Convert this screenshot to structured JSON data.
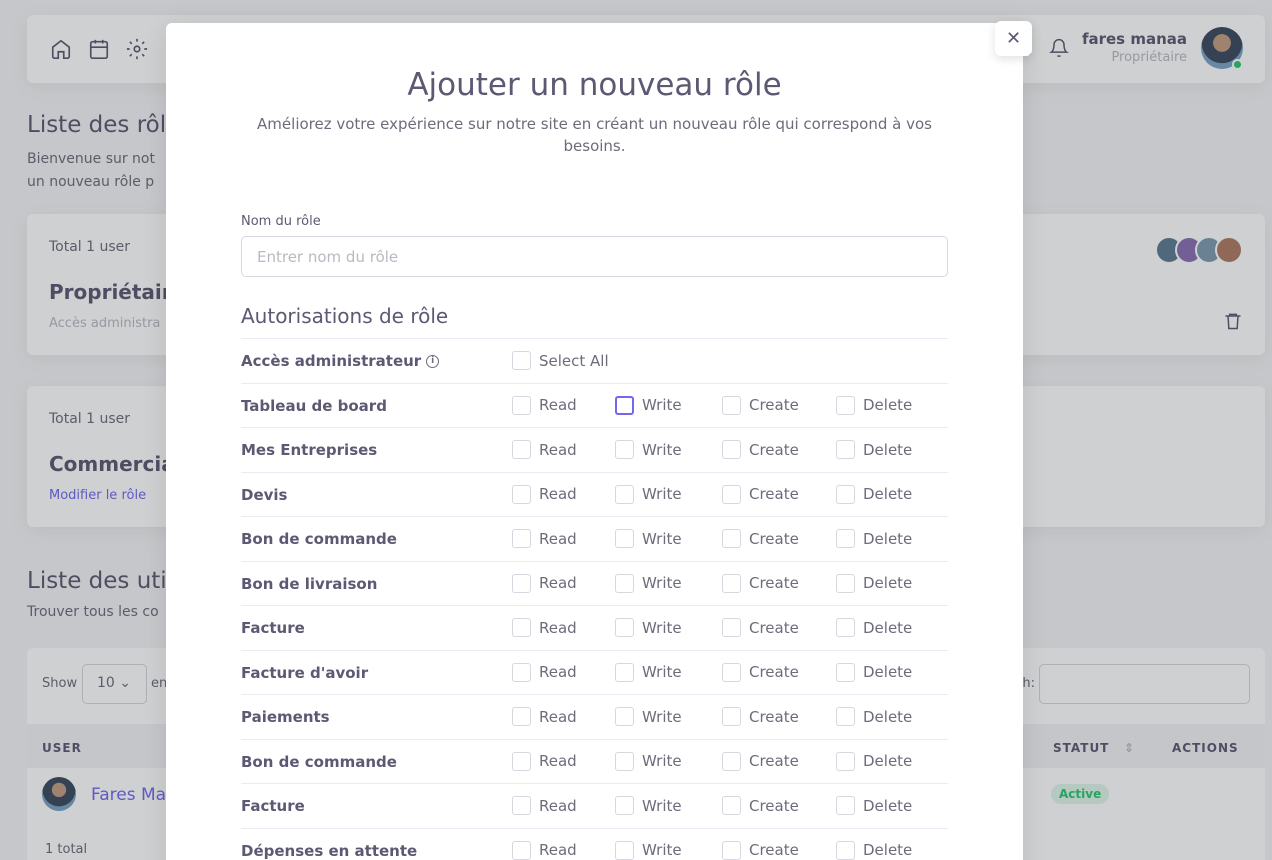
{
  "topbar": {
    "user_name": "fares manaa",
    "user_role": "Propriétaire"
  },
  "background": {
    "roles_title": "Liste des rôl",
    "roles_text_line1": "Bienvenue sur not",
    "roles_text_line2": "un nouveau rôle p",
    "card1": {
      "total": "Total 1 user",
      "role": "Propriétaire",
      "link": "Accès administra"
    },
    "card2": {
      "total": "Total 1 user",
      "role": "Commercia",
      "link": "Modifier le rôle"
    },
    "users_title": "Liste des uti",
    "users_text": "Trouver tous les co",
    "table": {
      "show_label": "Show",
      "show_value": "10",
      "show_after": "en",
      "search_label": "h:",
      "col_user": "USER",
      "col_status": "STATUT",
      "col_actions": "ACTIONS",
      "row_name": "Fares Ma",
      "row_status": "Active",
      "total": "1 total"
    }
  },
  "modal": {
    "title": "Ajouter un nouveau rôle",
    "subtitle": "Améliorez votre expérience sur notre site en créant un nouveau rôle qui correspond à vos besoins.",
    "name_label": "Nom du rôle",
    "name_placeholder": "Entrer nom du rôle",
    "permissions_title": "Autorisations de rôle",
    "admin_label": "Accès administrateur",
    "select_all_label": "Select All",
    "perm_labels": {
      "read": "Read",
      "write": "Write",
      "create": "Create",
      "delete": "Delete"
    },
    "rows": [
      "Tableau de board",
      "Mes Entreprises",
      "Devis",
      "Bon de commande",
      "Bon de livraison",
      "Facture",
      "Facture d'avoir",
      "Paiements",
      "Bon de commande",
      "Facture",
      "Dépenses en attente"
    ]
  },
  "icons": [
    "home-icon",
    "calendar-icon",
    "settings-icon",
    "search-icon",
    "bell-icon",
    "trash-icon",
    "info-icon",
    "close-icon"
  ],
  "colors": {
    "accent": "#7367f0",
    "success": "#28c76f",
    "heading": "#5e5873",
    "text": "#6e6b7b"
  }
}
